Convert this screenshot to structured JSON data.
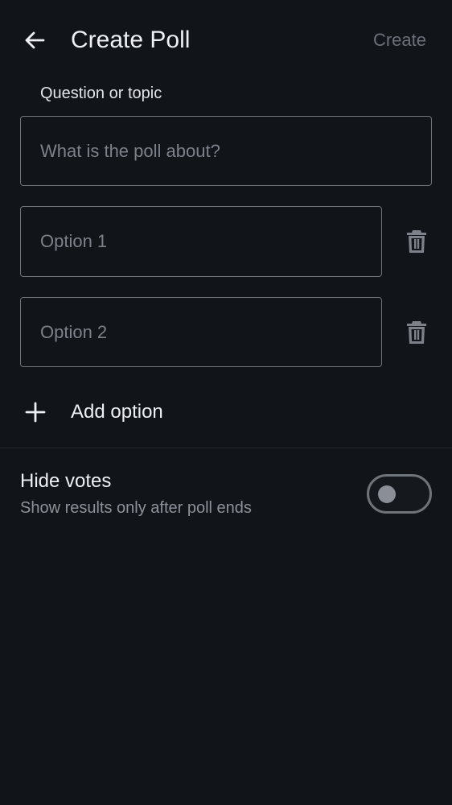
{
  "header": {
    "title": "Create Poll",
    "create_label": "Create"
  },
  "question": {
    "label": "Question or topic",
    "placeholder": "What is the poll about?",
    "value": ""
  },
  "options": [
    {
      "placeholder": "Option 1",
      "value": ""
    },
    {
      "placeholder": "Option 2",
      "value": ""
    }
  ],
  "add_option": {
    "label": "Add option"
  },
  "hide_votes": {
    "title": "Hide votes",
    "subtitle": "Show results only after poll ends",
    "enabled": false
  },
  "icons": {
    "back": "arrow-left-icon",
    "delete": "trash-icon",
    "add": "plus-icon"
  },
  "colors": {
    "background": "#111418",
    "border": "#6f737a",
    "text": "#eef0f3",
    "muted": "#8d929a",
    "disabled": "#6b7079"
  }
}
